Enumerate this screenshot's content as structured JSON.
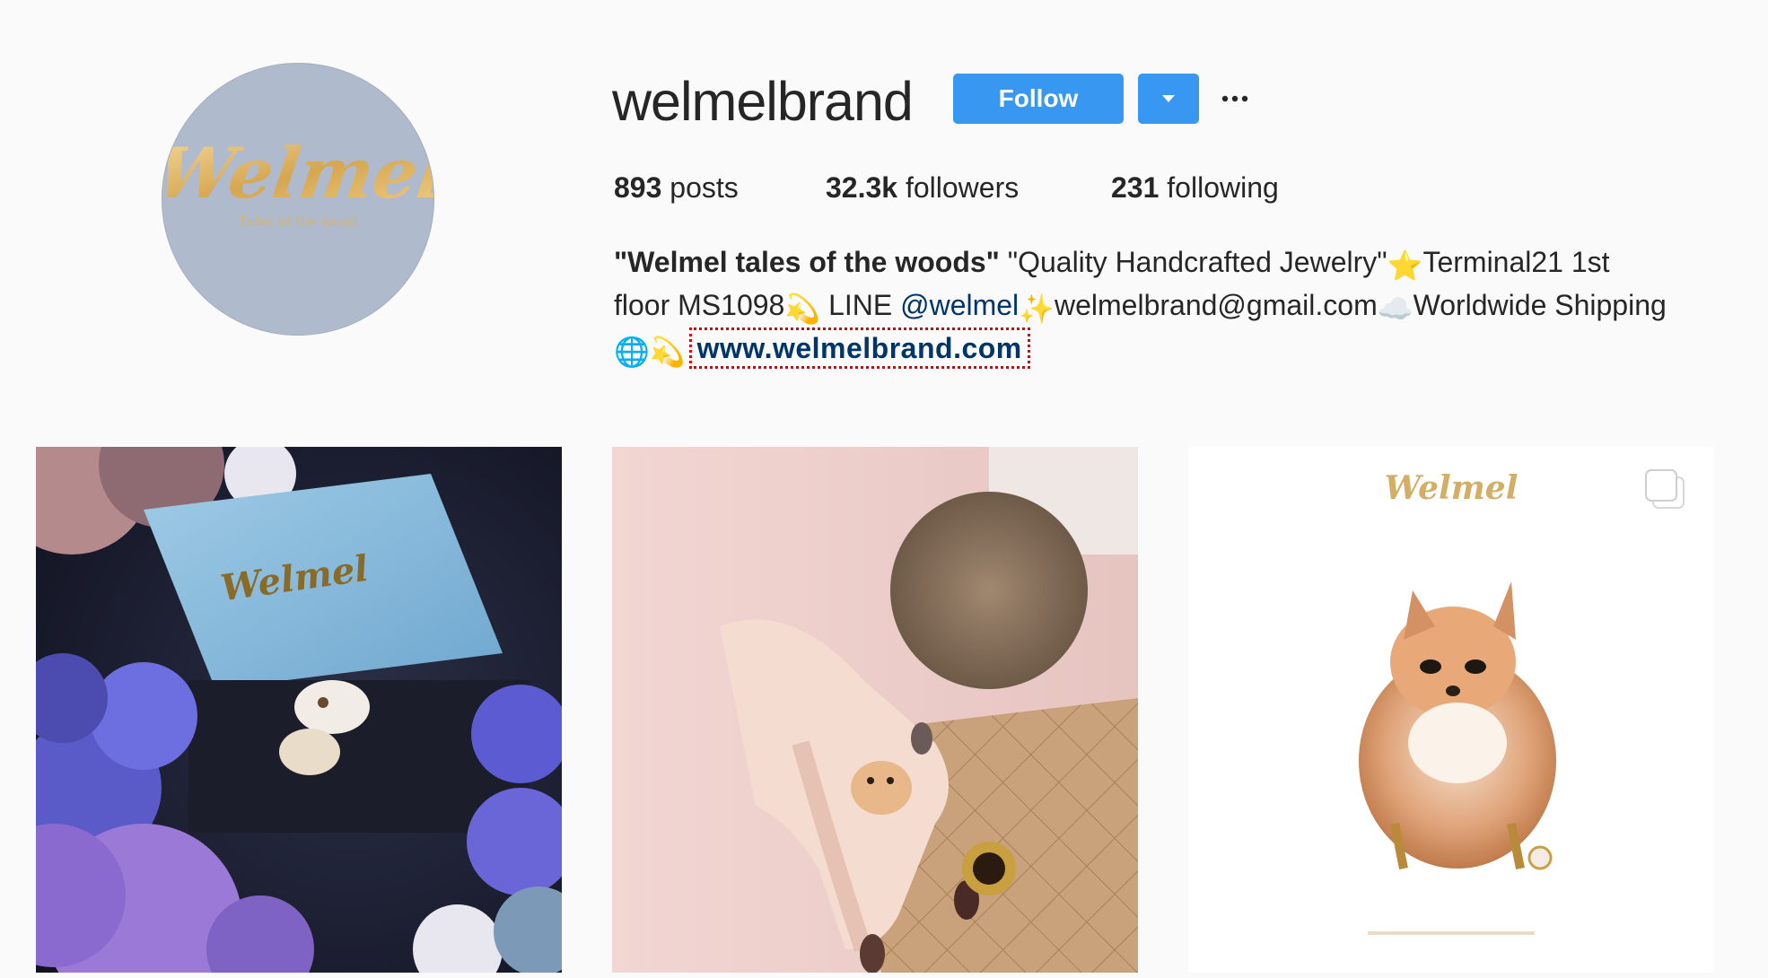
{
  "profile": {
    "username": "welmelbrand",
    "avatar": {
      "logo_text": "Welmel",
      "tagline": "Tales of the wood"
    },
    "follow_label": "Follow",
    "dropdown_icon": "caret-down-icon",
    "more_icon": "more-icon"
  },
  "stats": {
    "posts_count": "893",
    "posts_label": "posts",
    "followers_count": "32.3k",
    "followers_label": "followers",
    "following_count": "231",
    "following_label": "following"
  },
  "bio": {
    "full_name": "\"Welmel tales of the woods\"",
    "part1": " \"Quality Handcrafted Jewelry\"",
    "star_emoji": "⭐",
    "part2": "Terminal21 1st",
    "part3": "floor MS1098",
    "comet_emoji": "💫",
    "part4": " LINE ",
    "mention": "@welmel",
    "sparkles_emoji": " ✨ ",
    "part5": "welmelbrand@gmail.com",
    "cloud_emoji": "☁️",
    "part6": "Worldwide Shipping",
    "globe_emoji": "🌐",
    "comet_emoji_2": "💫",
    "website": "www.welmelbrand.com"
  },
  "posts": [
    {
      "id": "post-1",
      "logo_text": "Welmel"
    },
    {
      "id": "post-2"
    },
    {
      "id": "post-3",
      "logo_text": "Welmel",
      "multi_icon": "multiple-images-icon"
    }
  ],
  "colors": {
    "accent": "#3897f0",
    "link": "#003569",
    "background": "#fafafa",
    "avatar": "#afbacc",
    "gold": "#d9b26a"
  }
}
